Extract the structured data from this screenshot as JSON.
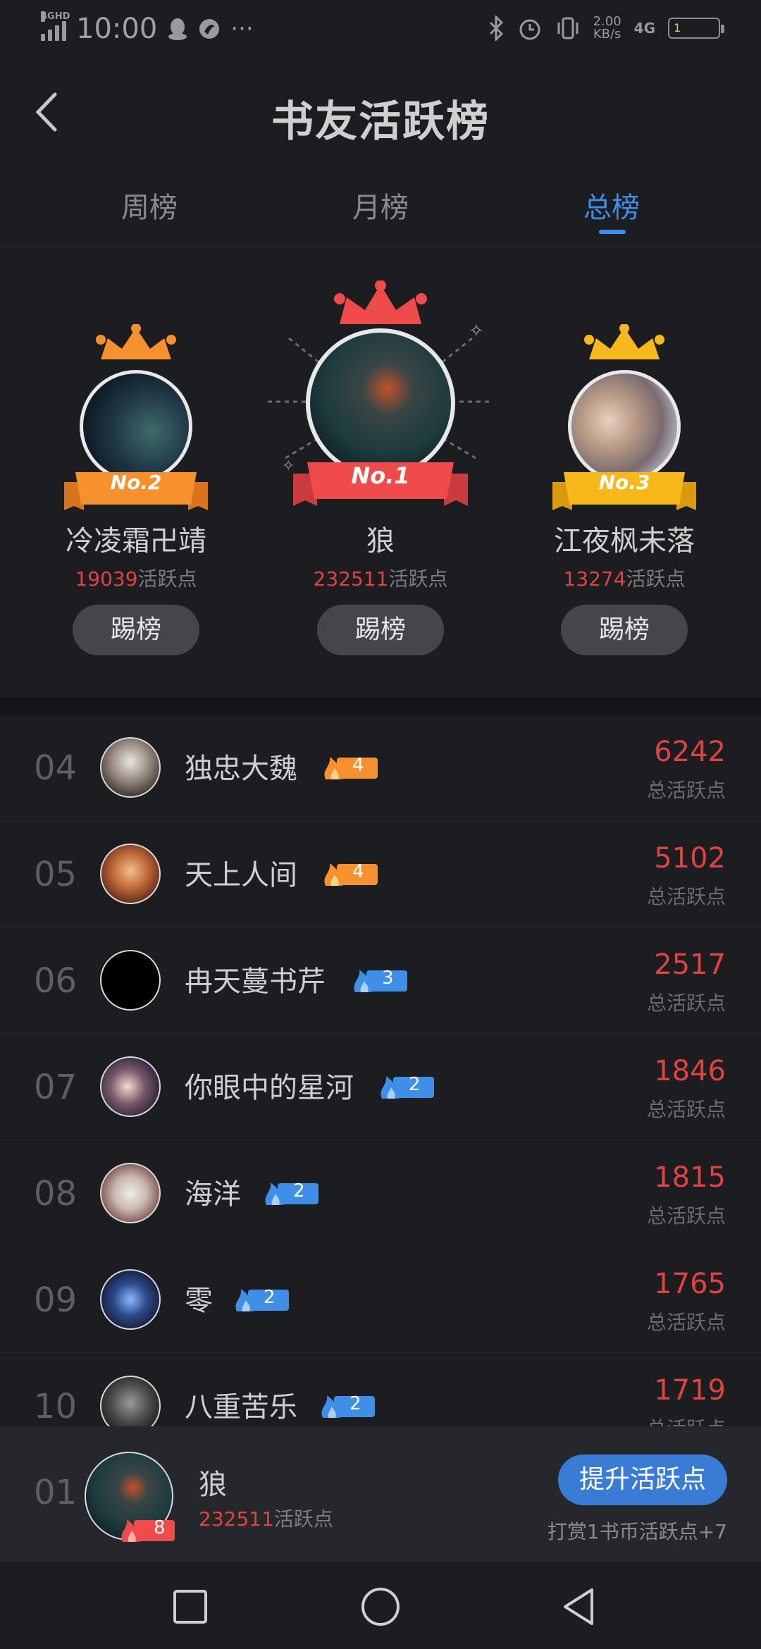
{
  "status_bar": {
    "network_label": "4GHD",
    "time": "10:00",
    "more": "···",
    "speed_value": "2.00",
    "speed_unit": "KB/s",
    "network_type": "4G",
    "battery": "1"
  },
  "header": {
    "title": "书友活跃榜"
  },
  "tabs": [
    {
      "label": "周榜",
      "active": false
    },
    {
      "label": "月榜",
      "active": false
    },
    {
      "label": "总榜",
      "active": true
    }
  ],
  "podium": {
    "first": {
      "badge": "No.1",
      "name": "狼",
      "score": "232511",
      "unit": "活跃点",
      "button": "踢榜"
    },
    "second": {
      "badge": "No.2",
      "name": "冷凌霜卍靖",
      "score": "19039",
      "unit": "活跃点",
      "button": "踢榜"
    },
    "third": {
      "badge": "No.3",
      "name": "江夜枫未落",
      "score": "13274",
      "unit": "活跃点",
      "button": "踢榜"
    }
  },
  "list": [
    {
      "rank": "04",
      "name": "独忠大魏",
      "level": "4",
      "score": "6242",
      "score_label": "总活跃点",
      "badge_color": "orange"
    },
    {
      "rank": "05",
      "name": "天上人间",
      "level": "4",
      "score": "5102",
      "score_label": "总活跃点",
      "badge_color": "orange"
    },
    {
      "rank": "06",
      "name": "冉天蔓书芹",
      "level": "3",
      "score": "2517",
      "score_label": "总活跃点",
      "badge_color": "blue"
    },
    {
      "rank": "07",
      "name": "你眼中的星河",
      "level": "2",
      "score": "1846",
      "score_label": "总活跃点",
      "badge_color": "blue"
    },
    {
      "rank": "08",
      "name": "海洋",
      "level": "2",
      "score": "1815",
      "score_label": "总活跃点",
      "badge_color": "blue"
    },
    {
      "rank": "09",
      "name": "零",
      "level": "2",
      "score": "1765",
      "score_label": "总活跃点",
      "badge_color": "blue"
    },
    {
      "rank": "10",
      "name": "八重苦乐",
      "level": "2",
      "score": "1719",
      "score_label": "总活跃点",
      "badge_color": "blue"
    }
  ],
  "my_rank": {
    "rank": "01",
    "name": "狼",
    "level": "8",
    "score": "232511",
    "unit": "活跃点",
    "button": "提升活跃点",
    "tip": "打赏1书币活跃点+7"
  },
  "colors": {
    "accent_blue": "#3f8ee8",
    "score_red": "#e0433f",
    "crown_red": "#f04b4b",
    "crown_orange": "#f6912e",
    "crown_gold": "#f7b81c"
  }
}
